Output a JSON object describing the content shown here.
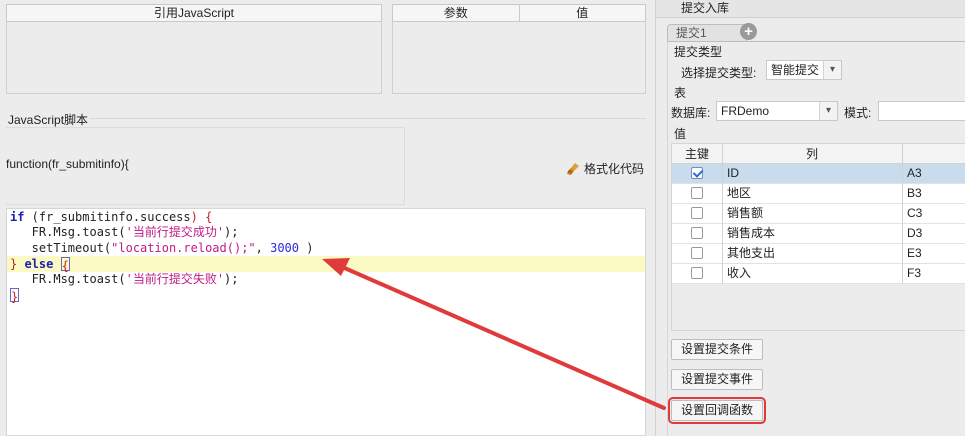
{
  "left": {
    "js_ref_header": "引用JavaScript",
    "param_header": {
      "col1": "参数",
      "col2": "值"
    },
    "script_label": "JavaScript脚本",
    "function_signature": "function(fr_submitinfo){",
    "format_button": "格式化代码",
    "code": {
      "line1": {
        "kw_if": "if",
        "open": " (",
        "expr": "fr_submitinfo.success",
        "close": ") ",
        "brace": "{"
      },
      "line2": {
        "call": "   FR.Msg.toast(",
        "str": "'当前行提交成功'",
        "end": ");"
      },
      "line3": {
        "call": "   setTimeout(",
        "str": "\"location.reload();\"",
        "mid": ", ",
        "num": "3000",
        "end": " )"
      },
      "line4": {
        "brace1": "}",
        "kw_else": " else ",
        "brace2": "{"
      },
      "line5": {
        "call": "   FR.Msg.toast(",
        "str": "'当前行提交失败'",
        "end": ");"
      },
      "line6": {
        "brace": "}"
      }
    }
  },
  "right": {
    "title": "提交入库",
    "tab_label": "提交1",
    "add_tab_icon": "+",
    "submit_type_section": "提交类型",
    "submit_type_label": "选择提交类型:",
    "submit_type_value": "智能提交",
    "table_section": "表",
    "db_label": "数据库:",
    "db_value": "FRDemo",
    "mode_label": "模式:",
    "value_section": "值",
    "grid_headers": {
      "pk": "主键",
      "col": "列"
    },
    "rows": [
      {
        "checked": true,
        "name": "ID",
        "cell": "A3"
      },
      {
        "checked": false,
        "name": "地区",
        "cell": "B3"
      },
      {
        "checked": false,
        "name": "销售额",
        "cell": "C3"
      },
      {
        "checked": false,
        "name": "销售成本",
        "cell": "D3"
      },
      {
        "checked": false,
        "name": "其他支出",
        "cell": "E3"
      },
      {
        "checked": false,
        "name": "收入",
        "cell": "F3"
      }
    ],
    "buttons": {
      "condition": "设置提交条件",
      "event": "设置提交事件",
      "callback": "设置回调函数"
    }
  },
  "colors": {
    "annotation_arrow": "#e03a3a",
    "highlight_line": "#fbf9c4",
    "selected_row": "#c8dcee"
  },
  "icons": {
    "format": "broom-icon",
    "add_tab": "plus-circle-icon",
    "dropdown": "chevron-down-icon",
    "annotation": "arrow-icon"
  }
}
